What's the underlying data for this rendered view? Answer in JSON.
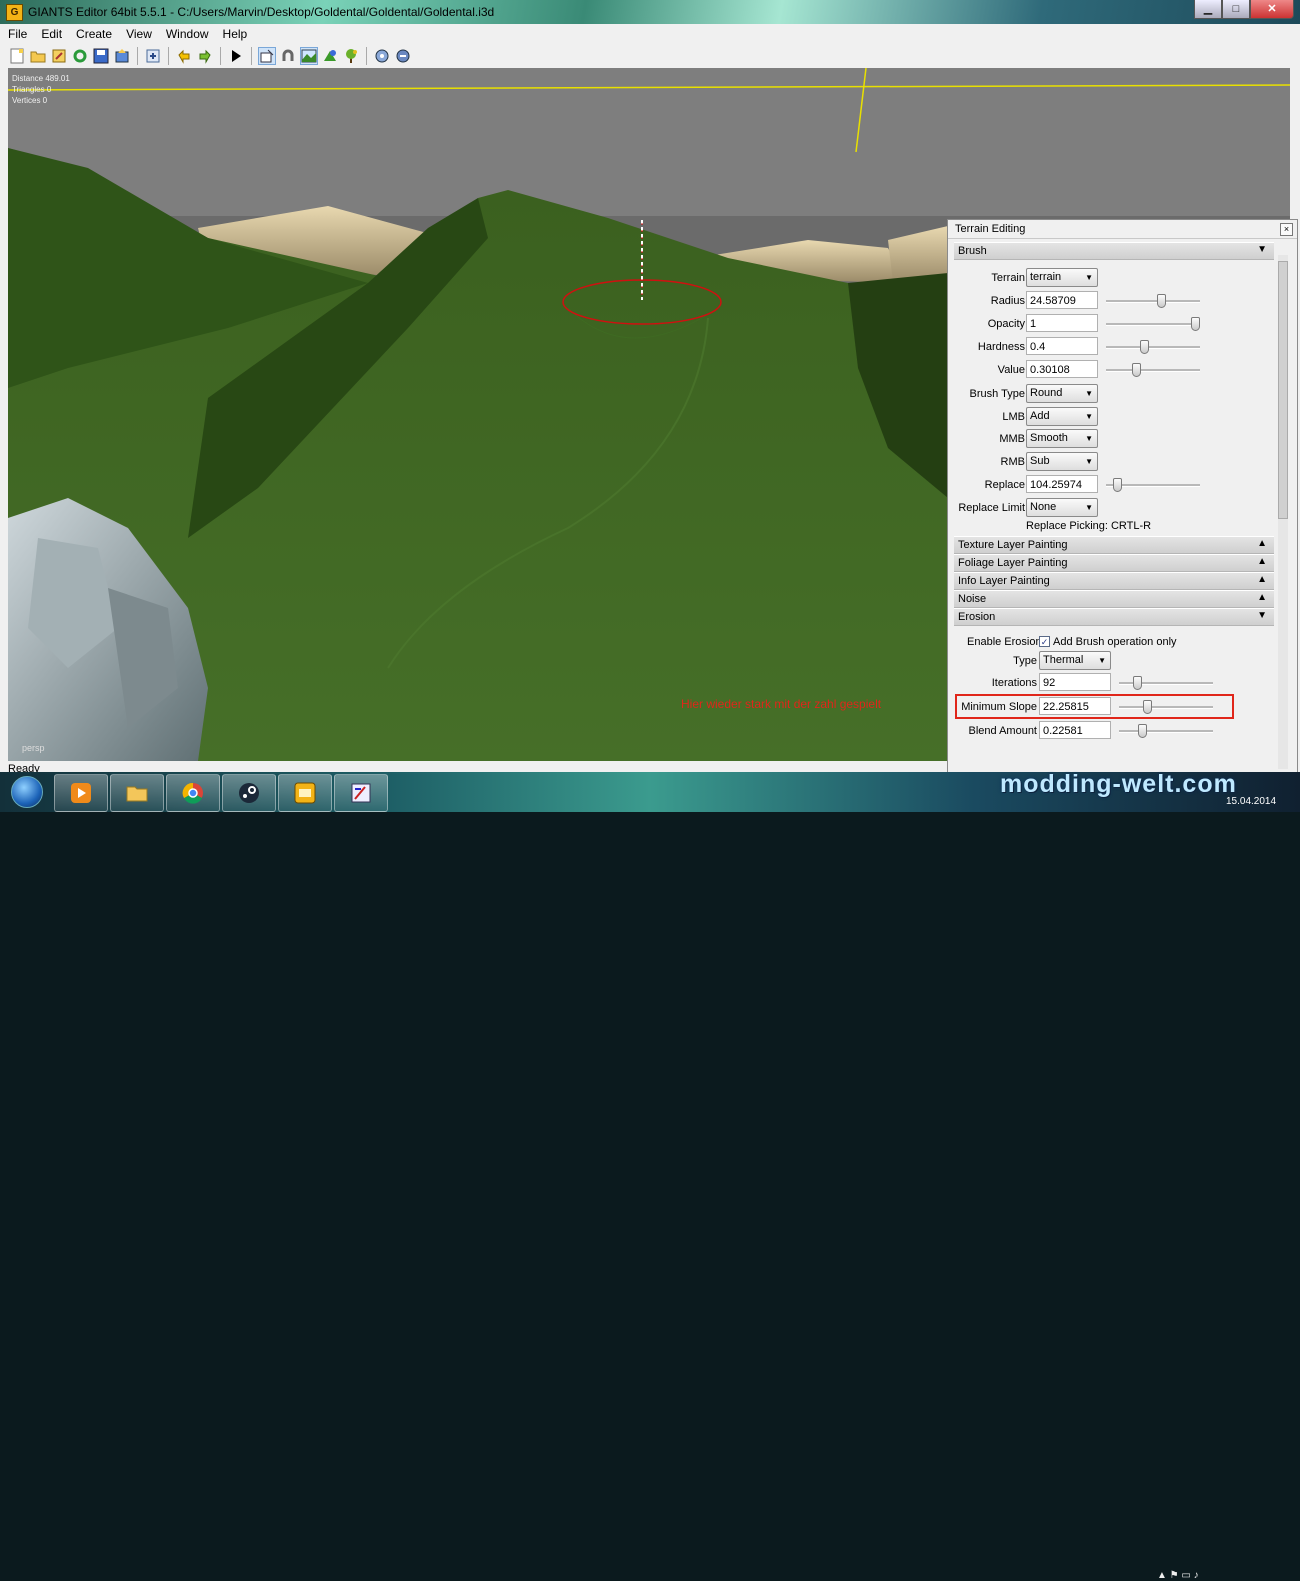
{
  "window": {
    "app_icon": "G",
    "title": "GIANTS Editor 64bit 5.5.1 - C:/Users/Marvin/Desktop/Goldental/Goldental/Goldental.i3d",
    "minimize": "▁",
    "maximize": "□",
    "close": "✕"
  },
  "menu": [
    "File",
    "Edit",
    "Create",
    "View",
    "Window",
    "Help"
  ],
  "toolbar": {
    "icons": [
      "new-file-icon",
      "open-folder-icon",
      "edit-icon",
      "refresh-icon",
      "save-icon",
      "export-icon",
      "import-icon",
      "undo-icon",
      "redo-icon",
      "play-icon",
      "select-icon",
      "magnet-icon",
      "terrain-icon",
      "paint-icon",
      "foliage-icon",
      "settings-icon",
      "settings-alt-icon"
    ]
  },
  "viewport": {
    "stats": [
      "Distance 489.01",
      "Triangles 0",
      "Vertices 0"
    ],
    "camera_label": "persp",
    "annotation": "Hier wieder stark mit der zahl gespielt"
  },
  "status": "Ready",
  "terrain_panel": {
    "title": "Terrain Editing",
    "close": "×",
    "brush_section": "Brush",
    "brush": {
      "terrain": {
        "label": "Terrain",
        "value": "terrain"
      },
      "radius": {
        "label": "Radius",
        "value": "24.58709",
        "level": 0.6
      },
      "opacity": {
        "label": "Opacity",
        "value": "1",
        "level": 1.0
      },
      "hardness": {
        "label": "Hardness",
        "value": "0.4",
        "level": 0.4
      },
      "value": {
        "label": "Value",
        "value": "0.30108",
        "level": 0.3
      },
      "brush_type": {
        "label": "Brush Type",
        "value": "Round"
      },
      "lmb": {
        "label": "LMB",
        "value": "Add"
      },
      "mmb": {
        "label": "MMB",
        "value": "Smooth"
      },
      "rmb": {
        "label": "RMB",
        "value": "Sub"
      },
      "replace": {
        "label": "Replace",
        "value": "104.25974",
        "level": 0.08
      },
      "replace_limit": {
        "label": "Replace Limit",
        "value": "None"
      },
      "picking": "Replace Picking: CRTL-R"
    },
    "collapsed_sections": [
      "Texture Layer Painting",
      "Foliage Layer Painting",
      "Info Layer Painting",
      "Noise"
    ],
    "erosion_section": "Erosion",
    "erosion": {
      "enable": {
        "label": "Enable Erosion",
        "checked": true,
        "check_label": "Add Brush operation only"
      },
      "type": {
        "label": "Type",
        "value": "Thermal"
      },
      "iterations": {
        "label": "Iterations",
        "value": "92",
        "level": 0.16
      },
      "minimum_slope": {
        "label": "Minimum Slope",
        "value": "22.25815",
        "level": 0.28
      },
      "blend_amount": {
        "label": "Blend Amount",
        "value": "0.22581",
        "level": 0.22
      }
    },
    "arrow_down": "▼",
    "arrow_up": "▲"
  },
  "taskbar": {
    "apps": [
      "media-player-icon",
      "explorer-icon",
      "chrome-icon",
      "steam-icon",
      "giants-editor-icon",
      "paint-app-icon"
    ],
    "watermark": "modding-welt.com",
    "date": "15.04.2014"
  },
  "colors": {
    "highlight": "#e0261a",
    "terrain": "#3f6a22",
    "sky": "#7e7e7e"
  }
}
